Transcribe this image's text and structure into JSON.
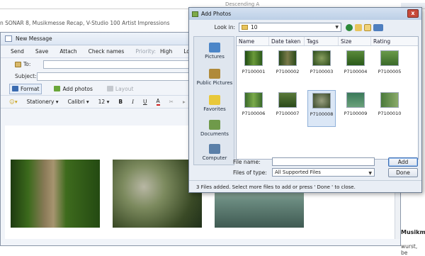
{
  "background": {
    "top_text": "Descending A",
    "headline": "n SONAR 8, Musikmesse Recap, V-Studio 100 Artist Impressions",
    "right_bold": "Musikme",
    "right_text": "wurst, be"
  },
  "message_window": {
    "title": "New Message",
    "toolbar": {
      "send": "Send",
      "save": "Save",
      "attach": "Attach",
      "check_names": "Check names",
      "priority": "Priority:",
      "high": "High",
      "low": "Low"
    },
    "to_label": "To:",
    "subject_label": "Subject:",
    "attach_bar": {
      "format": "Format",
      "add_photos": "Add photos",
      "layout": "Layout"
    },
    "format_bar": {
      "stationery": "Stationery",
      "font": "Calibri",
      "size": "12",
      "bold": "B",
      "italic": "I",
      "underline": "U",
      "font_color": "A"
    }
  },
  "dialog": {
    "title": "Add Photos",
    "close": "x",
    "look_in_label": "Look in:",
    "look_in_value": "10",
    "places": [
      "Pictures",
      "Public Pictures",
      "Favorites",
      "Documents",
      "Computer"
    ],
    "columns": [
      "Name",
      "Date taken",
      "Tags",
      "Size",
      "Rating"
    ],
    "files": [
      "P7100001",
      "P7100002",
      "P7100003",
      "P7100004",
      "P7100005",
      "P7100006",
      "P7100007",
      "P7100008",
      "P7100009",
      "P7100010"
    ],
    "file_name_label": "File name:",
    "file_name_value": "",
    "files_of_type_label": "Files of type:",
    "files_of_type_value": "All Supported Files",
    "add_button": "Add",
    "done_button": "Done",
    "status": "3 Files added. Select more files to add or press ' Done ' to close."
  }
}
